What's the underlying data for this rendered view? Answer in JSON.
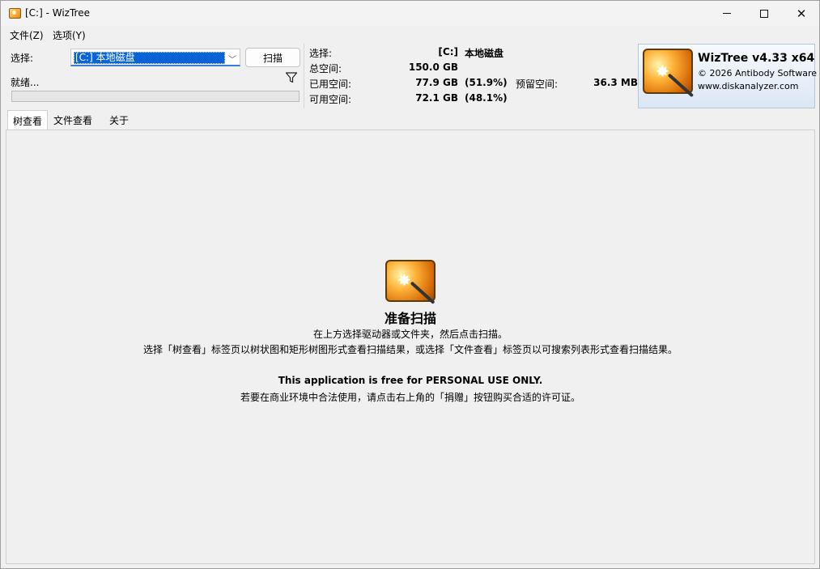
{
  "window": {
    "title": "[C:]  - WizTree"
  },
  "menu": {
    "file": "文件(Z)",
    "options": "选项(Y)"
  },
  "scan_panel": {
    "select_label": "选择:",
    "drive_value": "[C:] 本地磁盘",
    "scan_button": "扫描",
    "status": "就绪...",
    "progress": 0
  },
  "drive_info": {
    "select_label": "选择:",
    "drive_letter": "[C:]",
    "drive_name": "本地磁盘",
    "total_label": "总空间:",
    "total_value": "150.0 GB",
    "used_label": "已用空间:",
    "used_value": "77.9 GB",
    "used_pct": "(51.9%)",
    "reserved_label": "预留空间:",
    "reserved_value": "36.3 MB",
    "free_label": "可用空间:",
    "free_value": "72.1 GB",
    "free_pct": "(48.1%)"
  },
  "branding": {
    "app_name": "WizTree v4.33 x64",
    "copyright": "© 2026 Antibody Software",
    "website": "www.diskanalyzer.com"
  },
  "tabs": {
    "tree": "树查看",
    "file": "文件查看",
    "about": "关于"
  },
  "content": {
    "title": "准备扫描",
    "line1": "在上方选择驱动器或文件夹，然后点击扫描。",
    "line2": "选择「树查看」标签页以树状图和矩形树图形式查看扫描结果，或选择「文件查看」标签页以可搜索列表形式查看扫描结果。",
    "line3": "This application is free for PERSONAL USE ONLY.",
    "line4": "若要在商业环境中合法使用，请点击右上角的「捐赠」按钮购买合适的许可证。"
  },
  "icons": {
    "app": "wizard-wand-icon",
    "filter": "filter-icon",
    "dropdown": "chevron-down-icon"
  },
  "colors": {
    "selection": "#0a64d6",
    "logo_orange": "#e88a12"
  }
}
